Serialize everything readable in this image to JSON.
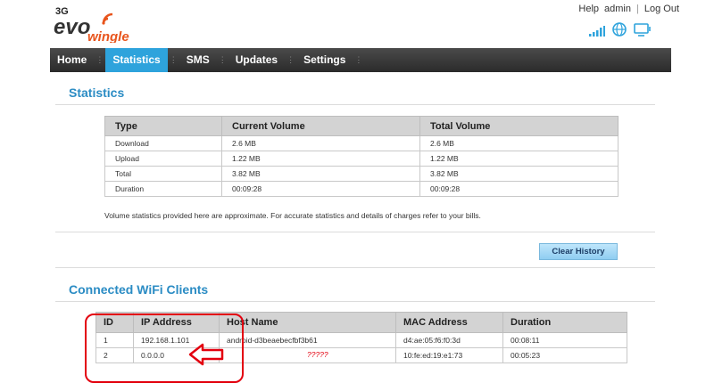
{
  "header": {
    "logo_text": "3G evo wingle",
    "links": [
      "Help",
      "admin",
      "Log Out"
    ]
  },
  "status_icons": [
    "signal-icon",
    "globe-icon",
    "monitor-icon"
  ],
  "nav": {
    "items": [
      {
        "label": "Home",
        "active": false
      },
      {
        "label": "Statistics",
        "active": true
      },
      {
        "label": "SMS",
        "active": false
      },
      {
        "label": "Updates",
        "active": false
      },
      {
        "label": "Settings",
        "active": false
      }
    ]
  },
  "statistics": {
    "title": "Statistics",
    "headers": [
      "Type",
      "Current Volume",
      "Total Volume"
    ],
    "rows": [
      [
        "Download",
        "2.6 MB",
        "2.6 MB"
      ],
      [
        "Upload",
        "1.22 MB",
        "1.22 MB"
      ],
      [
        "Total",
        "3.82 MB",
        "3.82 MB"
      ],
      [
        "Duration",
        "00:09:28",
        "00:09:28"
      ]
    ],
    "note": "Volume statistics provided here are approximate. For accurate statistics and details of charges refer to your bills.",
    "clear_button": "Clear History"
  },
  "clients": {
    "title": "Connected WiFi Clients",
    "headers": [
      "ID",
      "IP Address",
      "Host Name",
      "MAC Address",
      "Duration"
    ],
    "rows": [
      [
        "1",
        "192.168.1.101",
        "android-d3beaebecfbf3b61",
        "d4:ae:05:f6:f0:3d",
        "00:08:11"
      ],
      [
        "2",
        "0.0.0.0",
        "",
        "10:fe:ed:19:e1:73",
        "00:05:23"
      ]
    ]
  },
  "annotation": {
    "question": "?????",
    "color": "#e3000f"
  },
  "colors": {
    "accent": "#2ea3dc",
    "title": "#2b8cc4"
  }
}
